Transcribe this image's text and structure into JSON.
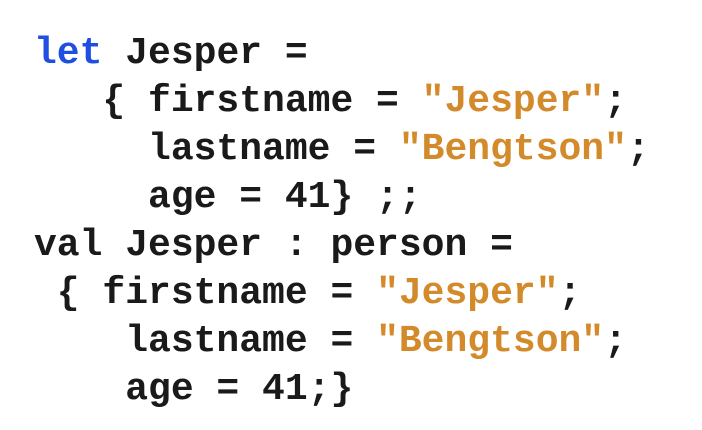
{
  "code": {
    "lines": [
      {
        "parts": [
          {
            "text": "let",
            "cls": "kw"
          },
          {
            "text": " Jesper =",
            "cls": ""
          }
        ]
      },
      {
        "parts": [
          {
            "text": "   { firstname = ",
            "cls": ""
          },
          {
            "text": "\"Jesper\"",
            "cls": "str"
          },
          {
            "text": ";",
            "cls": ""
          }
        ]
      },
      {
        "parts": [
          {
            "text": "     lastname = ",
            "cls": ""
          },
          {
            "text": "\"Bengtson\"",
            "cls": "str"
          },
          {
            "text": ";",
            "cls": ""
          }
        ]
      },
      {
        "parts": [
          {
            "text": "     age = 41} ;;",
            "cls": ""
          }
        ]
      },
      {
        "parts": [
          {
            "text": "val Jesper : person =",
            "cls": ""
          }
        ]
      },
      {
        "parts": [
          {
            "text": " { firstname = ",
            "cls": ""
          },
          {
            "text": "\"Jesper\"",
            "cls": "str"
          },
          {
            "text": ";",
            "cls": ""
          }
        ]
      },
      {
        "parts": [
          {
            "text": "    lastname = ",
            "cls": ""
          },
          {
            "text": "\"Bengtson\"",
            "cls": "str"
          },
          {
            "text": ";",
            "cls": ""
          }
        ]
      },
      {
        "parts": [
          {
            "text": "    age = 41;}",
            "cls": ""
          }
        ]
      }
    ]
  },
  "colors": {
    "keyword": "#1f4fe0",
    "string": "#d38a2a",
    "text": "#1a1a1a",
    "background": "#ffffff"
  }
}
